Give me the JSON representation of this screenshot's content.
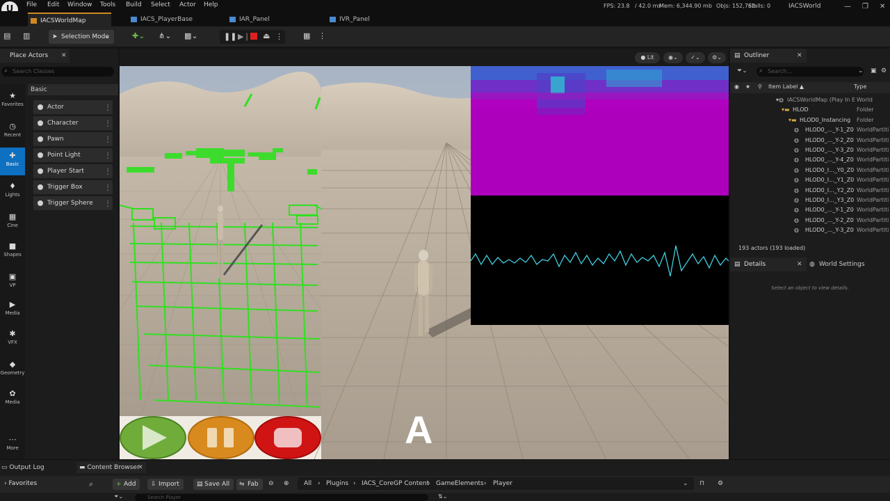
{
  "menu": [
    "File",
    "Edit",
    "Window",
    "Tools",
    "Build",
    "Select",
    "Actor",
    "Help"
  ],
  "logo": "U",
  "stats": {
    "fps": "FPS: 23.8",
    "ms": "/ 42.0 ms",
    "mem": "Mem: 6,344.90 mb",
    "objs": "Objs: 152,762",
    "stalls": "Stalls: 0",
    "world": "IACSWorld"
  },
  "doc_tabs": [
    "IACSWorldMap",
    "IACS_PlayerBase",
    "IAR_Panel",
    "IVR_Panel"
  ],
  "toolbar": {
    "selection_mode": "Selection Mode"
  },
  "place_actors": {
    "tab": "Place Actors",
    "search_placeholder": "Search Classes",
    "section": "Basic",
    "items": [
      "Actor",
      "Character",
      "Pawn",
      "Point Light",
      "Player Start",
      "Trigger Box",
      "Trigger Sphere"
    ]
  },
  "categories": [
    {
      "label": "Favorites",
      "icon": "★"
    },
    {
      "label": "Recent",
      "icon": "◷"
    },
    {
      "label": "Basic",
      "icon": "✚"
    },
    {
      "label": "Lights",
      "icon": "♦"
    },
    {
      "label": "Cine",
      "icon": "▦"
    },
    {
      "label": "Shapes",
      "icon": "■"
    },
    {
      "label": "VP",
      "icon": "▣"
    },
    {
      "label": "Media",
      "icon": "▶"
    },
    {
      "label": "VFX",
      "icon": "✱"
    },
    {
      "label": "Geometry",
      "icon": "◆"
    },
    {
      "label": "Media",
      "icon": "✿"
    },
    {
      "label": "More",
      "icon": "⋯"
    }
  ],
  "viewport": {
    "lit_label": "Lit",
    "overlay_letter": "A"
  },
  "outliner": {
    "tab": "Outliner",
    "search_placeholder": "Search...",
    "col_label": "Item Label ▲",
    "col_type": "Type",
    "rows": [
      {
        "label": "IACSWorldMap (Play In E",
        "type": "World",
        "indent": 78
      },
      {
        "label": "HLOD",
        "type": "Folder",
        "indent": 86
      },
      {
        "label": "HLOD0_Instancing",
        "type": "Folder",
        "indent": 96
      },
      {
        "label": "HLOD0_..._Y-1_Z0",
        "type": "WorldPartiti",
        "indent": 104
      },
      {
        "label": "HLOD0_..._Y-2_Z0",
        "type": "WorldPartiti",
        "indent": 104
      },
      {
        "label": "HLOD0_..._Y-3_Z0",
        "type": "WorldPartiti",
        "indent": 104
      },
      {
        "label": "HLOD0_..._Y-4_Z0",
        "type": "WorldPartiti",
        "indent": 104
      },
      {
        "label": "HLOD0_I..._Y0_Z0",
        "type": "WorldPartiti",
        "indent": 104
      },
      {
        "label": "HLOD0_I..._Y1_Z0",
        "type": "WorldPartiti",
        "indent": 104
      },
      {
        "label": "HLOD0_I..._Y2_Z0",
        "type": "WorldPartiti",
        "indent": 104
      },
      {
        "label": "HLOD0_I..._Y3_Z0",
        "type": "WorldPartiti",
        "indent": 104
      },
      {
        "label": "HLOD0_..._Y-1_Z0",
        "type": "WorldPartiti",
        "indent": 104
      },
      {
        "label": "HLOD0_..._Y-2_Z0",
        "type": "WorldPartiti",
        "indent": 104
      },
      {
        "label": "HLOD0_..._Y-3_Z0",
        "type": "WorldPartiti",
        "indent": 104
      }
    ],
    "count": "193 actors (193 loaded)"
  },
  "details": {
    "tab": "Details",
    "world_settings_tab": "World Settings",
    "empty_text": "Select an object to view details."
  },
  "bottom": {
    "output_log": "Output Log",
    "content_browser": "Content Browser",
    "favorites": "Favorites",
    "add": "Add",
    "import": "Import",
    "save_all": "Save All",
    "fab": "Fab",
    "breadcrumbs": [
      "All",
      "Plugins",
      "IACS_CoreGP Content",
      "GameElements",
      "Player"
    ],
    "search_placeholder": "Search Player"
  },
  "colors": {
    "accent": "#0e70c0",
    "tab_active": "#d08a20",
    "play_green": "#6fac3a",
    "pause_orange": "#d88a1e",
    "stop_red": "#d01414",
    "spectro_magenta": "#b000c0",
    "wave_cyan": "#40d0e0"
  }
}
